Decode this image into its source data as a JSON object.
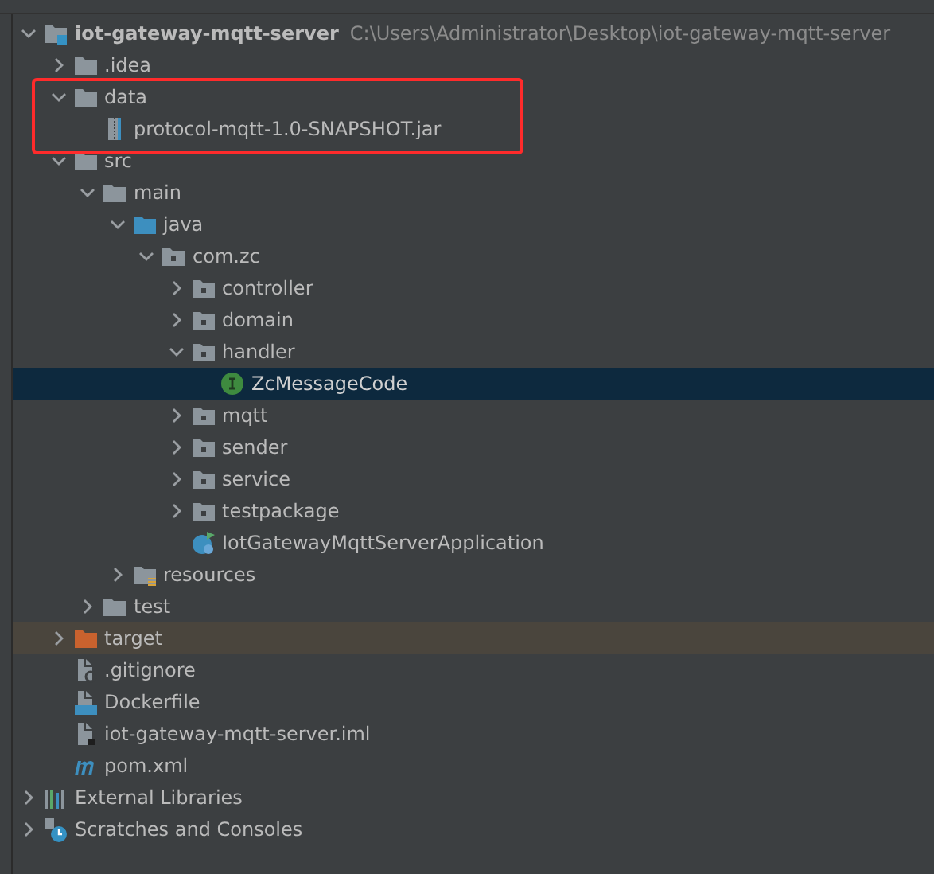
{
  "tree": [
    {
      "name": "iot-gateway-mqtt-server",
      "path": "C:\\Users\\Administrator\\Desktop\\iot-gateway-mqtt-server",
      "kind": "module",
      "expanded": true,
      "selected": false,
      "children": [
        {
          "name": ".idea",
          "kind": "folder",
          "expanded": false,
          "selected": false
        },
        {
          "name": "data",
          "kind": "folder",
          "expanded": true,
          "selected": false,
          "boxed": true,
          "children": [
            {
              "name": "protocol-mqtt-1.0-SNAPSHOT.jar",
              "kind": "jar",
              "selected": false
            }
          ]
        },
        {
          "name": "src",
          "kind": "folder",
          "expanded": true,
          "selected": false,
          "children": [
            {
              "name": "main",
              "kind": "folder",
              "expanded": true,
              "selected": false,
              "children": [
                {
                  "name": "java",
                  "kind": "source",
                  "expanded": true,
                  "selected": false,
                  "children": [
                    {
                      "name": "com.zc",
                      "kind": "package",
                      "expanded": true,
                      "selected": false,
                      "children": [
                        {
                          "name": "controller",
                          "kind": "package",
                          "expanded": false,
                          "selected": false
                        },
                        {
                          "name": "domain",
                          "kind": "package",
                          "expanded": false,
                          "selected": false
                        },
                        {
                          "name": "handler",
                          "kind": "package",
                          "expanded": true,
                          "selected": false,
                          "children": [
                            {
                              "name": "ZcMessageCode",
                              "kind": "interface",
                              "selected": true
                            }
                          ]
                        },
                        {
                          "name": "mqtt",
                          "kind": "package",
                          "expanded": false,
                          "selected": false
                        },
                        {
                          "name": "sender",
                          "kind": "package",
                          "expanded": false,
                          "selected": false
                        },
                        {
                          "name": "service",
                          "kind": "package",
                          "expanded": false,
                          "selected": false
                        },
                        {
                          "name": "testpackage",
                          "kind": "package",
                          "expanded": false,
                          "selected": false
                        },
                        {
                          "name": "IotGatewayMqttServerApplication",
                          "kind": "spring",
                          "selected": false
                        }
                      ]
                    }
                  ]
                },
                {
                  "name": "resources",
                  "kind": "resources",
                  "expanded": false,
                  "selected": false
                }
              ]
            },
            {
              "name": "test",
              "kind": "folder",
              "expanded": false,
              "selected": false
            }
          ]
        },
        {
          "name": "target",
          "kind": "excluded",
          "expanded": false,
          "selected": false
        },
        {
          "name": ".gitignore",
          "kind": "gitignore",
          "selected": false
        },
        {
          "name": "Dockerfile",
          "kind": "docker",
          "selected": false
        },
        {
          "name": "iot-gateway-mqtt-server.iml",
          "kind": "iml",
          "selected": false
        },
        {
          "name": "pom.xml",
          "kind": "maven",
          "selected": false
        }
      ]
    },
    {
      "name": "External Libraries",
      "kind": "libraries",
      "expanded": false,
      "selected": false
    },
    {
      "name": "Scratches and Consoles",
      "kind": "scratches",
      "expanded": false,
      "selected": false
    }
  ]
}
